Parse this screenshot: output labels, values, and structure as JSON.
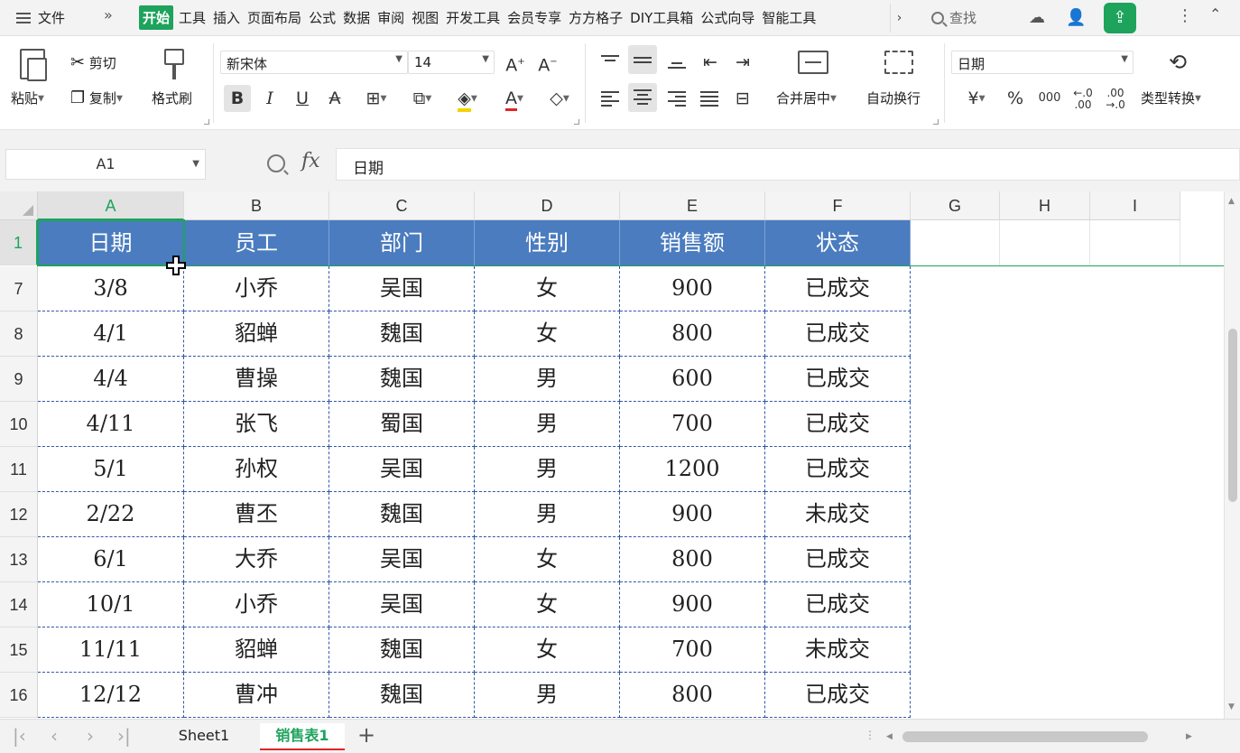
{
  "menubar": {
    "file_label": "文件",
    "more_label": "»",
    "tabs": [
      "开始",
      "工具",
      "插入",
      "页面布局",
      "公式",
      "数据",
      "审阅",
      "视图",
      "开发工具",
      "会员专享",
      "方方格子",
      "DIY工具箱",
      "公式向导",
      "智能工具"
    ],
    "search_label": "查找"
  },
  "ribbon": {
    "paste_label": "粘贴",
    "cut_label": "剪切",
    "copy_label": "复制",
    "format_painter_label": "格式刷",
    "font_name": "新宋体",
    "font_size": "14",
    "merge_center_label": "合并居中",
    "wrap_text_label": "自动换行",
    "number_format": "日期",
    "type_convert_label": "类型转换",
    "currency_symbol": "¥",
    "percent_symbol": "%",
    "thousands_symbol": "000"
  },
  "formula_bar": {
    "name_box": "A1",
    "fx_label": "fx",
    "content": "日期"
  },
  "grid": {
    "column_letters": [
      "A",
      "B",
      "C",
      "D",
      "E",
      "F",
      "G",
      "H",
      "I"
    ],
    "header_row_number": "1",
    "header": [
      "日期",
      "员工",
      "部门",
      "性别",
      "销售额",
      "状态"
    ],
    "rows": [
      {
        "num": "7",
        "cells": [
          "3/8",
          "小乔",
          "吴国",
          "女",
          "900",
          "已成交"
        ]
      },
      {
        "num": "8",
        "cells": [
          "4/1",
          "貂蝉",
          "魏国",
          "女",
          "800",
          "已成交"
        ]
      },
      {
        "num": "9",
        "cells": [
          "4/4",
          "曹操",
          "魏国",
          "男",
          "600",
          "已成交"
        ]
      },
      {
        "num": "10",
        "cells": [
          "4/11",
          "张飞",
          "蜀国",
          "男",
          "700",
          "已成交"
        ]
      },
      {
        "num": "11",
        "cells": [
          "5/1",
          "孙权",
          "吴国",
          "男",
          "1200",
          "已成交"
        ]
      },
      {
        "num": "12",
        "cells": [
          "2/22",
          "曹丕",
          "魏国",
          "男",
          "900",
          "未成交"
        ]
      },
      {
        "num": "13",
        "cells": [
          "6/1",
          "大乔",
          "吴国",
          "女",
          "800",
          "已成交"
        ]
      },
      {
        "num": "14",
        "cells": [
          "10/1",
          "小乔",
          "吴国",
          "女",
          "900",
          "已成交"
        ]
      },
      {
        "num": "15",
        "cells": [
          "11/11",
          "貂蝉",
          "魏国",
          "女",
          "700",
          "未成交"
        ]
      },
      {
        "num": "16",
        "cells": [
          "12/12",
          "曹冲",
          "魏国",
          "男",
          "800",
          "已成交"
        ]
      }
    ]
  },
  "sheets": {
    "tabs": [
      "Sheet1",
      "销售表1"
    ],
    "active": "销售表1",
    "add_label": "+"
  },
  "colors": {
    "accent": "#1ea35c",
    "header_fill": "#4a7cbf",
    "selection_border": "#1ea35c"
  }
}
